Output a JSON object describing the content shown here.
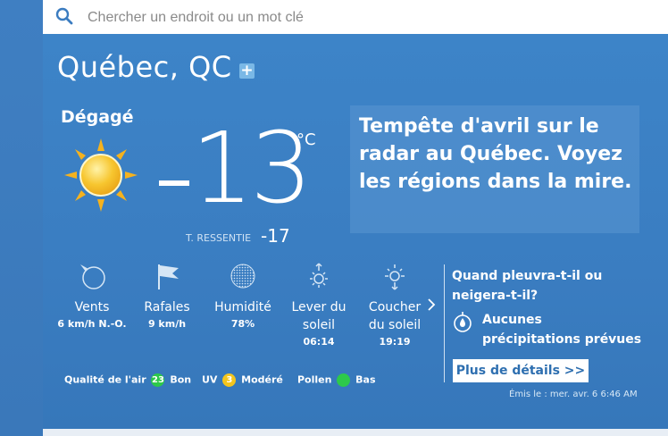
{
  "search": {
    "placeholder": "Chercher un endroit ou un mot clé"
  },
  "location": {
    "name": "Québec, QC",
    "add_symbol": "+"
  },
  "current": {
    "condition": "Dégagé",
    "temperature": "13",
    "unit": "°C",
    "feels_like_label": "T. RESSENTIE",
    "feels_like_value": "-17"
  },
  "news": {
    "headline": "Tempête d'avril sur le radar au Québec. Voyez les régions dans la mire."
  },
  "details": [
    {
      "label": "Vents",
      "value": "6 km/h N.-O.",
      "icon": "wind-icon"
    },
    {
      "label": "Rafales",
      "value": "9 km/h",
      "icon": "gust-flag-icon"
    },
    {
      "label": "Humidité",
      "value": "78%",
      "icon": "humidity-icon"
    },
    {
      "label": "Lever du soleil",
      "value": "06:14",
      "icon": "sunrise-icon"
    },
    {
      "label": "Coucher du soleil",
      "value": "19:19",
      "icon": "sunset-icon"
    }
  ],
  "precipitation": {
    "title": "Quand pleuvra-t-il ou neigera-t-il?",
    "text": "Aucunes précipitations prévues",
    "button": "Plus de détails >>",
    "issued": "Émis le : mer. avr. 6 6:46 AM"
  },
  "indices": {
    "air_label": "Qualité de l'air",
    "air_value": "23",
    "air_text": "Bon",
    "uv_label": "UV",
    "uv_value": "3",
    "uv_text": "Modéré",
    "pollen_label": "Pollen",
    "pollen_text": "Bas"
  },
  "colors": {
    "accent": "#3b7cc0",
    "good": "#2dc94a",
    "moderate": "#f4c51d"
  }
}
